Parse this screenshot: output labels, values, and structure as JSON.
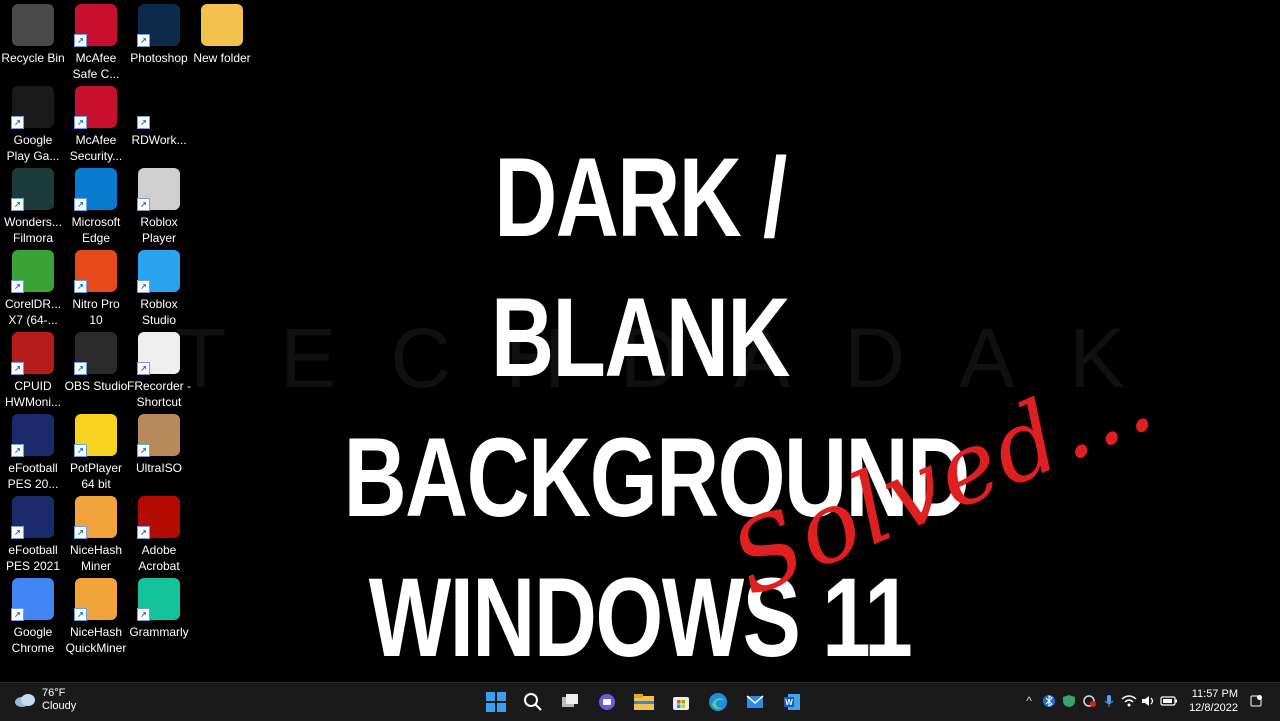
{
  "desktop": {
    "icons": [
      {
        "label": "Recycle Bin",
        "icon": "recycle-bin-icon",
        "color": "#4a4a4a"
      },
      {
        "label": "McAfee\nSafe C...",
        "icon": "mcafee-lock-icon",
        "color": "#c8102e"
      },
      {
        "label": "Photoshop",
        "icon": "photoshop-icon",
        "color": "#0c2a4a"
      },
      {
        "label": "New folder",
        "icon": "folder-icon",
        "color": "#f2c14e"
      },
      {
        "label": "Google\nPlay Ga...",
        "icon": "google-play-games-icon",
        "color": "#1a1a1a"
      },
      {
        "label": "McAfee\nSecurity...",
        "icon": "mcafee-security-icon",
        "color": "#c8102e"
      },
      {
        "label": "RDWork...",
        "icon": "rdwork-icon",
        "color": "#000000"
      },
      {
        "label": "Wonders...\nFilmora",
        "icon": "filmora-icon",
        "color": "#1e3b3b"
      },
      {
        "label": "Microsoft\nEdge",
        "icon": "edge-icon",
        "color": "#0b7bd1"
      },
      {
        "label": "Roblox\nPlayer",
        "icon": "roblox-icon",
        "color": "#cfcfcf"
      },
      {
        "label": "CorelDR...\nX7 (64-...",
        "icon": "coreldraw-icon",
        "color": "#3aa335"
      },
      {
        "label": "Nitro Pro\n10",
        "icon": "nitro-icon",
        "color": "#e64a19"
      },
      {
        "label": "Roblox\nStudio",
        "icon": "roblox-studio-icon",
        "color": "#2aa3ee"
      },
      {
        "label": "CPUID\nHWMoni...",
        "icon": "hwmonitor-icon",
        "color": "#b71c1c"
      },
      {
        "label": "OBS Studio",
        "icon": "obs-icon",
        "color": "#2b2b2b"
      },
      {
        "label": "FRecorder -\nShortcut",
        "icon": "frecorder-icon",
        "color": "#eeeeee"
      },
      {
        "label": "eFootball\nPES 20...",
        "icon": "efootball-icon",
        "color": "#1a2a6a"
      },
      {
        "label": "PotPlayer\n64 bit",
        "icon": "potplayer-icon",
        "color": "#f7d21e"
      },
      {
        "label": "UltraISO",
        "icon": "ultraiso-icon",
        "color": "#b88a5a"
      },
      {
        "label": "eFootball\nPES 2021",
        "icon": "efootball-icon",
        "color": "#1a2a6a"
      },
      {
        "label": "NiceHash\nMiner",
        "icon": "nicehash-icon",
        "color": "#f3a33c"
      },
      {
        "label": "Adobe\nAcrobat",
        "icon": "acrobat-icon",
        "color": "#b30b00"
      },
      {
        "label": "Google\nChrome",
        "icon": "chrome-icon",
        "color": "#4285f4"
      },
      {
        "label": "NiceHash\nQuickMiner",
        "icon": "nicehash-quickminer-icon",
        "color": "#f3a33c"
      },
      {
        "label": "Grammarly",
        "icon": "grammarly-icon",
        "color": "#15c39a"
      }
    ],
    "headline_lines": [
      "DARK / BLANK",
      "BACKGROUND",
      "WINDOWS 11"
    ],
    "solved": "Solved...",
    "watermark": "TECHDADAK",
    "accent_red": "#e02020"
  },
  "taskbar": {
    "weather_temp": "76°F",
    "weather_text": "Cloudy",
    "apps": [
      "start-icon",
      "search-icon",
      "task-view-icon",
      "chat-icon",
      "file-explorer-icon",
      "store-icon",
      "edge-icon",
      "mail-icon",
      "word-icon"
    ],
    "time": "11:57 PM",
    "date": "12/8/2022"
  }
}
